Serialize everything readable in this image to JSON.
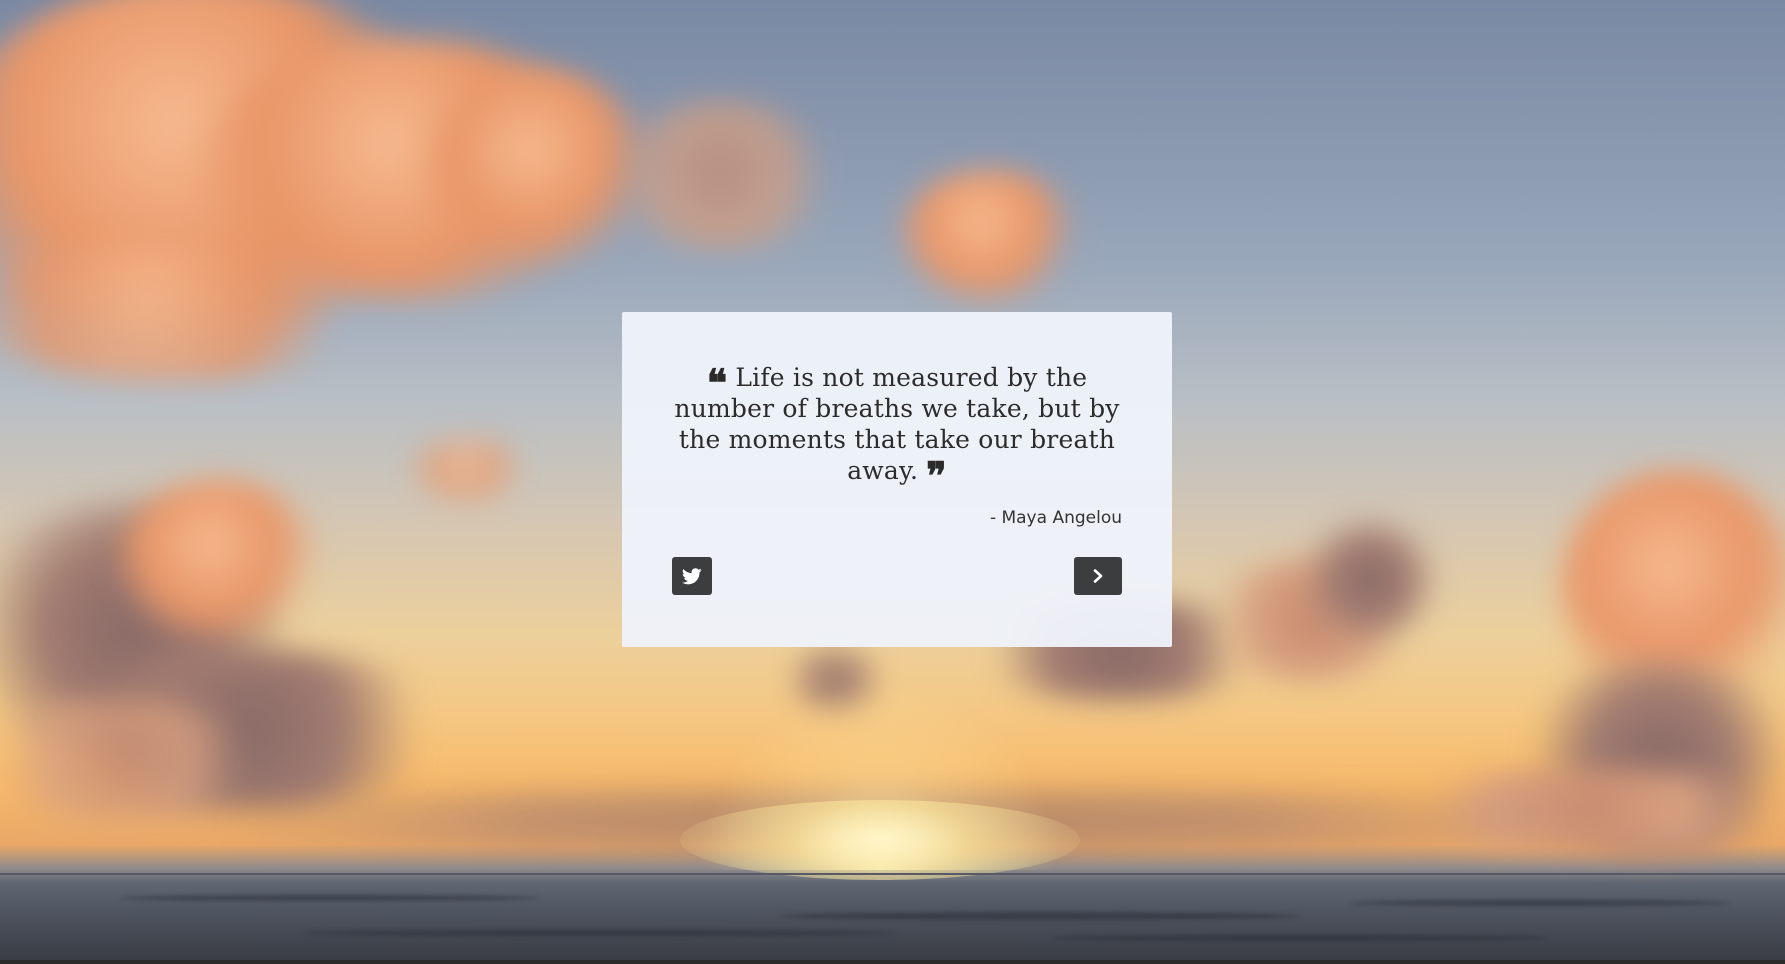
{
  "quote": {
    "text": "Life is not measured by the number of breaths we take, but by the moments that take our breath away.",
    "author": "- Maya Angelou",
    "open_mark_icon": "quote-left-icon",
    "close_mark_icon": "quote-right-icon"
  },
  "actions": {
    "tweet_icon": "twitter-icon",
    "next_icon": "chevron-right-icon"
  },
  "colors": {
    "card_background": "#eef2fa",
    "button_background": "#3c3d3e",
    "text": "#2c2c2c"
  }
}
